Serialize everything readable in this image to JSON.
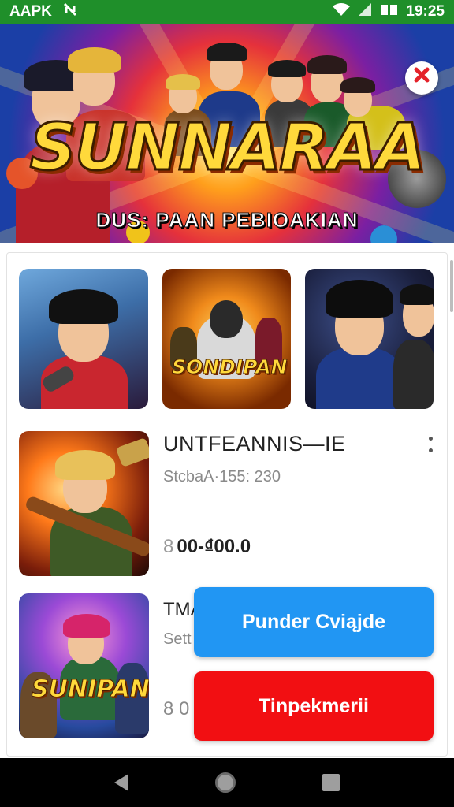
{
  "status_bar": {
    "app_label": "AAPK",
    "time": "19:25",
    "icons": [
      "notification-icon",
      "wifi-icon",
      "signal-icon",
      "battery-icon"
    ]
  },
  "banner": {
    "title": "SUNNARAA",
    "subtitle": "DUS: PAAN PEBIOAKIAN",
    "close_icon": "close-icon",
    "slides": 3,
    "active_slide": 0
  },
  "grid_tiles": [
    {
      "name": "tile-singer"
    },
    {
      "name": "tile-sondipan",
      "art_text": "SONDIPAN"
    },
    {
      "name": "tile-microphone"
    }
  ],
  "list": {
    "item1": {
      "title": "UNTFEANNIS—IE",
      "subtitle": "StcbaA·155: 230",
      "price": "00-₫00.0",
      "price_icon": "8",
      "more_icon": "more-vertical-icon"
    },
    "item2": {
      "title": "TMA",
      "subtitle": "Sett",
      "price": "8 0",
      "art_text": "SUNIPAN"
    }
  },
  "buttons": {
    "primary": "Punder Cviąjde",
    "secondary": "Tinpekmerii"
  },
  "colors": {
    "status_bar": "#1f8f2a",
    "primary_button": "#2196f3",
    "secondary_button": "#f20f12",
    "close_icon": "#e4222a"
  }
}
